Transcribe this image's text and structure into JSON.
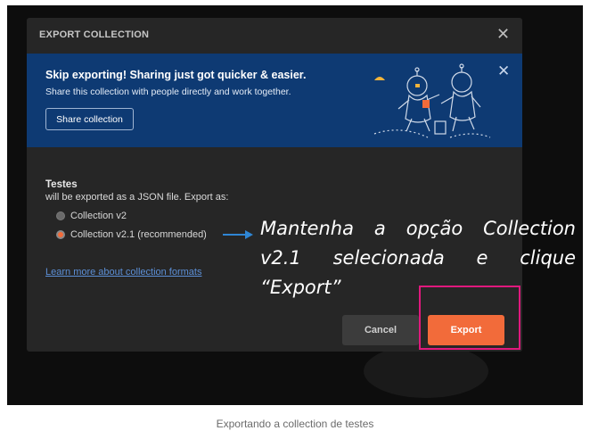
{
  "modal": {
    "title": "EXPORT COLLECTION",
    "close_icon": "close-icon",
    "banner": {
      "title": "Skip exporting! Sharing just got quicker & easier.",
      "text": "Share this collection with people directly and work together.",
      "share_button": "Share collection",
      "close_icon": "close-icon",
      "illustration": "astronauts-illustration"
    },
    "collection_name": "Testes",
    "description": "will be exported as a JSON file. Export as:",
    "options": [
      {
        "label": "Collection v2",
        "selected": false
      },
      {
        "label": "Collection v2.1 (recommended)",
        "selected": true
      }
    ],
    "learn_more_link": "Learn more about collection formats",
    "cancel_button": "Cancel",
    "export_button": "Export"
  },
  "annotation": {
    "text": "Mantenha a opção Collection v2.1 selecionada e clique “Export”",
    "arrow_icon": "arrow-right-icon",
    "highlight_color": "#e0197d"
  },
  "colors": {
    "accent": "#f26b3a",
    "banner": "#0e3a73",
    "modal_bg": "#262626"
  },
  "caption": "Exportando a collection de testes"
}
